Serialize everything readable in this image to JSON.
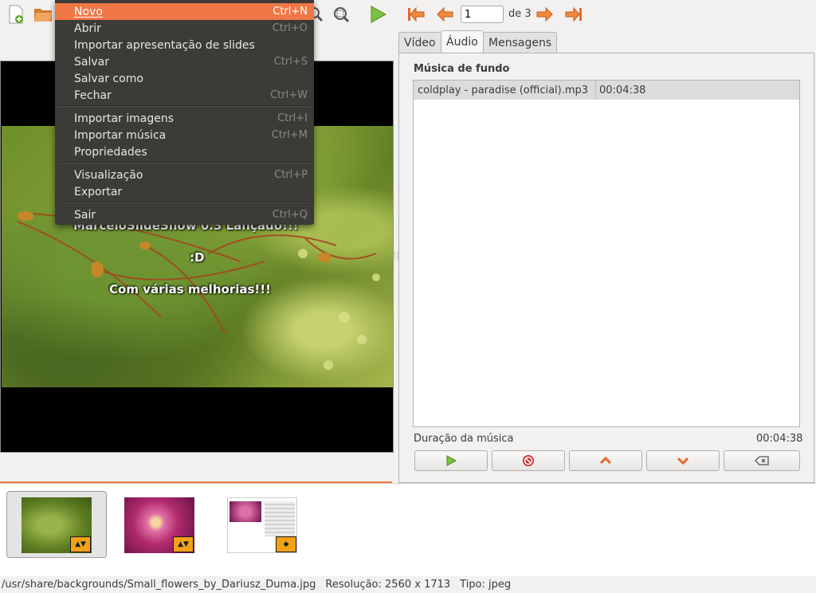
{
  "toolbar": {
    "page_value": "1",
    "page_of": "de 3"
  },
  "menu": {
    "items": [
      {
        "label": "Novo",
        "accel": "Ctrl+N"
      },
      {
        "label": "Abrir",
        "accel": "Ctrl+O"
      },
      {
        "label": "Importar apresentação de slides",
        "accel": ""
      },
      {
        "label": "Salvar",
        "accel": "Ctrl+S"
      },
      {
        "label": "Salvar como",
        "accel": ""
      },
      {
        "label": "Fechar",
        "accel": "Ctrl+W"
      },
      {
        "label": "Importar imagens",
        "accel": "Ctrl+I"
      },
      {
        "label": "Importar música",
        "accel": "Ctrl+M"
      },
      {
        "label": "Propriedades",
        "accel": ""
      },
      {
        "label": "Visualização",
        "accel": "Ctrl+P"
      },
      {
        "label": "Exportar",
        "accel": ""
      },
      {
        "label": "Sair",
        "accel": "Ctrl+Q"
      }
    ]
  },
  "preview": {
    "line1": "MarceloSlideShow  0.3 Lançado!!!",
    "line2": ":D",
    "line3": "Com várias melhorias!!!"
  },
  "tabs": [
    "Vídeo",
    "Áudio",
    "Mensagens"
  ],
  "audio": {
    "section_title": "Música de fundo",
    "track_name": "coldplay - paradise (official).mp3",
    "track_duration": "00:04:38",
    "duration_label": "Duração da música",
    "duration_value": "00:04:38"
  },
  "status": {
    "path": "/usr/share/backgrounds/Small_flowers_by_Dariusz_Duma.jpg",
    "resolution": "Resolução: 2560 x 1713",
    "type": "Tipo: jpeg"
  },
  "colors": {
    "menu_bg": "#3c3b37",
    "menu_highlight": "#f07746",
    "accent_orange": "#f07746",
    "play_green": "#6fb32a"
  }
}
